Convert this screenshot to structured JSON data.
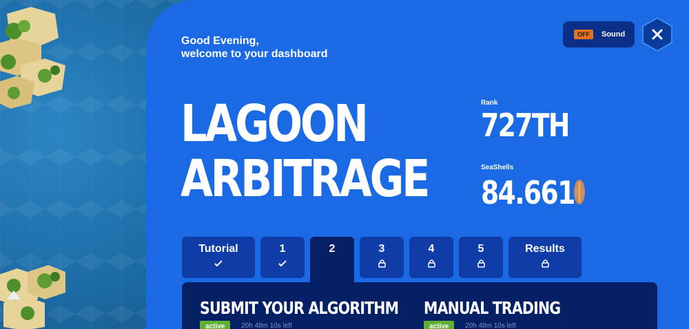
{
  "greeting": {
    "line1": "Good Evening,",
    "line2": "welcome to your dashboard"
  },
  "sound": {
    "state": "OFF",
    "label": "Sound"
  },
  "close": {
    "icon": "close-icon"
  },
  "title": {
    "line1": "LAGOON",
    "line2": "ARBITRAGE"
  },
  "stats": {
    "rank_label": "Rank",
    "rank_value": "727TH",
    "seashells_label": "SeaShells",
    "seashells_value": "84.661",
    "seashell_icon": "seashell-icon"
  },
  "tabs": [
    {
      "label": "Tutorial",
      "icon": "check-icon",
      "active": false
    },
    {
      "label": "1",
      "icon": "check-icon",
      "active": false
    },
    {
      "label": "2",
      "icon": "",
      "active": true
    },
    {
      "label": "3",
      "icon": "lock-icon",
      "active": false
    },
    {
      "label": "4",
      "icon": "lock-icon",
      "active": false
    },
    {
      "label": "5",
      "icon": "lock-icon",
      "active": false
    },
    {
      "label": "Results",
      "icon": "lock-icon",
      "active": false
    }
  ],
  "sections": [
    {
      "title": "SUBMIT YOUR ALGORITHM",
      "status": "active",
      "time_left": "20h 48m 10s left"
    },
    {
      "title": "MANUAL TRADING",
      "status": "active",
      "time_left": "20h 48m 10s left"
    }
  ],
  "colors": {
    "panel": "#1a6ae6",
    "tab": "#0e3da8",
    "active_tab": "#062066",
    "badge": "#5db033",
    "sound_off": "#e2741f"
  }
}
